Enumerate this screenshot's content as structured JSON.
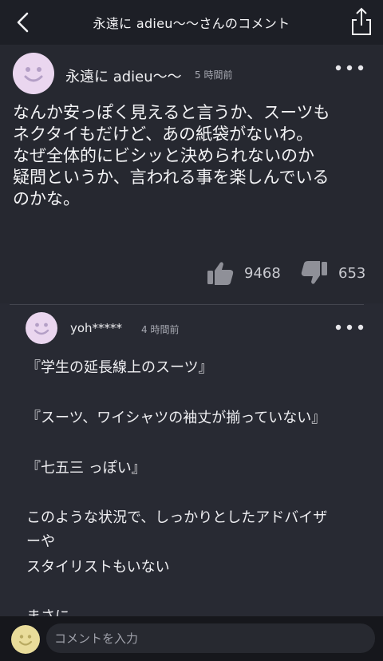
{
  "header": {
    "title": "永遠に adieu〜〜さんのコメント"
  },
  "comment": {
    "author": "永遠に adieu〜〜",
    "time": "5 時間前",
    "body_lines": [
      "なんか安っぽく見えると言うか、スーツも",
      "ネクタイもだけど、あの紙袋がないわ。",
      "なぜ全体的にビシッと決められないのか",
      "疑問というか、言われる事を楽しんでいる",
      "のかな。"
    ],
    "likes": "9468",
    "dislikes": "653"
  },
  "reply": {
    "author": "yoh*****",
    "time": "4 時間前",
    "lines": [
      "『学生の延長線上のスーツ』",
      "『スーツ、ワイシャツの袖丈が揃っていない』",
      "『七五三 っぽい』",
      "このような状況で、しっかりとしたアドバイザ",
      "ーや",
      "スタイリストもいない",
      "まさに"
    ]
  },
  "input": {
    "placeholder": "コメントを入力"
  },
  "colors": {
    "header_bg": "#1d1f26",
    "comment_bg": "#262830",
    "avatar_bg": "#ead6ef",
    "avatar_face": "#b49fc6",
    "input_avatar": "#e9dc9a"
  },
  "icons": [
    "back-chevron-icon",
    "share-icon",
    "more-icon",
    "thumbs-up-icon",
    "thumbs-down-icon",
    "smiley-avatar-icon"
  ]
}
